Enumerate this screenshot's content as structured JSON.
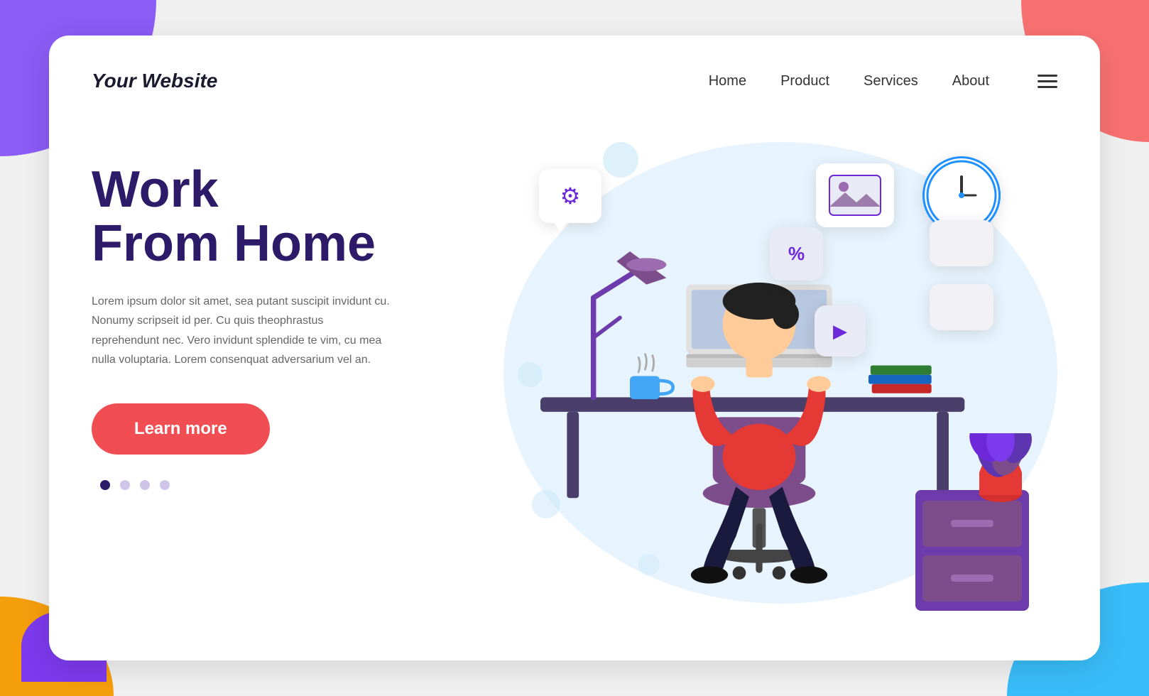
{
  "page": {
    "background_corners": {
      "tl_color": "#8B5CF6",
      "tr_color": "#F87171",
      "bl_color": "#F59E0B",
      "br_color": "#38BDF8"
    }
  },
  "header": {
    "logo": "Your Website",
    "nav": {
      "home": "Home",
      "product": "Product",
      "services": "Services",
      "about": "About"
    }
  },
  "hero": {
    "title_line1": "Work",
    "title_line2": "From Home",
    "description": "Lorem ipsum dolor sit amet, sea putant suscipit invidunt cu. Nonumy scripseit id per. Cu quis theophrastus reprehendunt nec. Vero invidunt splendide te vim, cu mea nulla voluptaria. Lorem consenquat adversarium vel an.",
    "cta_button": "Learn more"
  },
  "dots": {
    "active": 1,
    "total": 4
  },
  "floating_icons": {
    "gear": "⚙",
    "percent": "%",
    "play": "▶",
    "image": "🖼"
  }
}
